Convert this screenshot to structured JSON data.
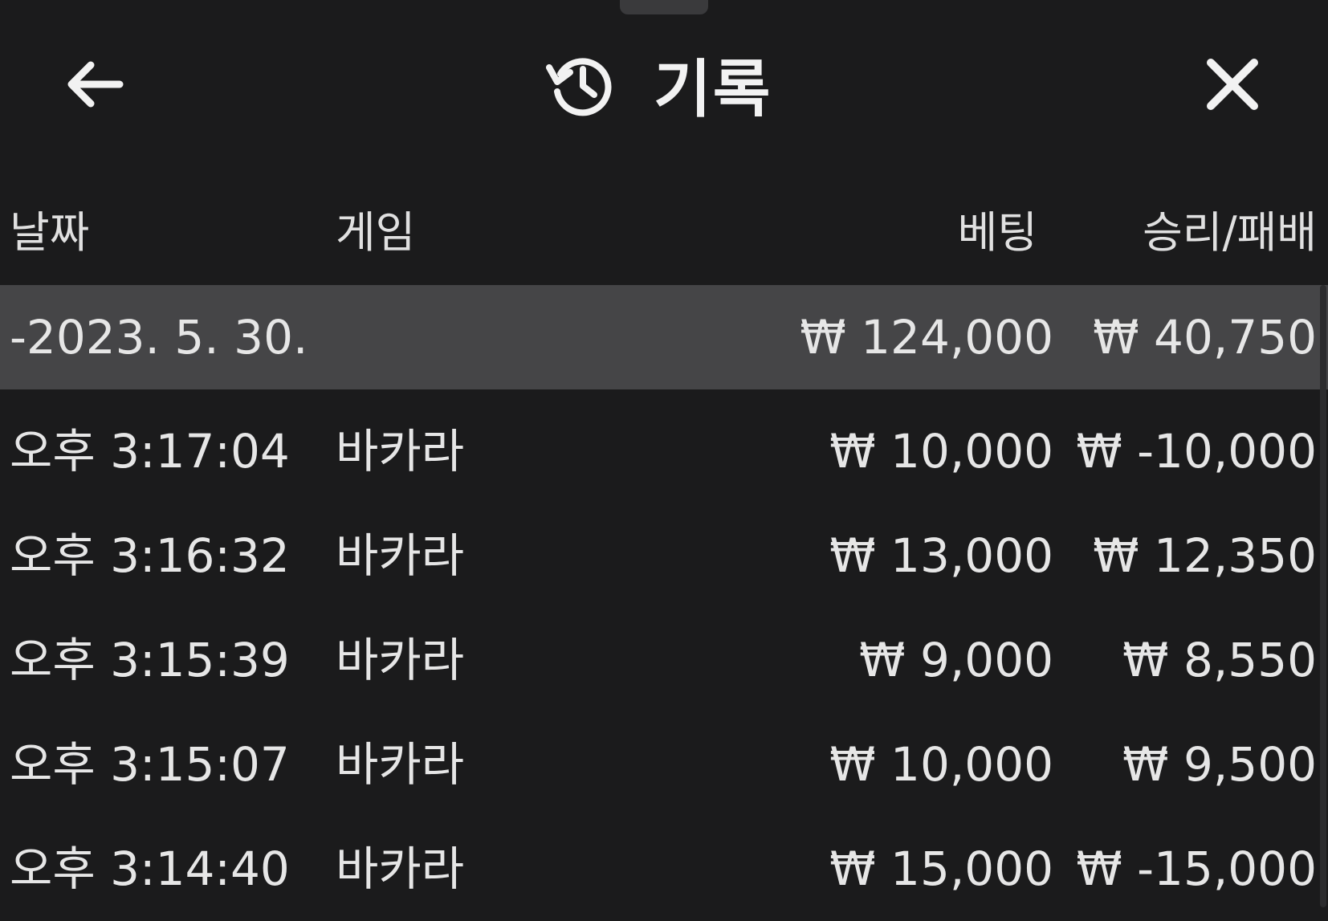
{
  "header": {
    "title": "기록",
    "back_icon": "arrow-left-icon",
    "history_icon": "history-icon",
    "close_icon": "close-icon"
  },
  "columns": {
    "date": "날짜",
    "game": "게임",
    "bet": "베팅",
    "result": "승리/패배"
  },
  "summary": {
    "date": "-2023. 5. 30.",
    "game": "",
    "bet": "₩ 124,000",
    "result": "₩ 40,750"
  },
  "rows": [
    {
      "date": "오후 3:17:04",
      "game": "바카라",
      "bet": "₩ 10,000",
      "result": "₩ -10,000"
    },
    {
      "date": "오후 3:16:32",
      "game": "바카라",
      "bet": "₩ 13,000",
      "result": "₩ 12,350"
    },
    {
      "date": "오후 3:15:39",
      "game": "바카라",
      "bet": "₩ 9,000",
      "result": "₩ 8,550"
    },
    {
      "date": "오후 3:15:07",
      "game": "바카라",
      "bet": "₩ 10,000",
      "result": "₩ 9,500"
    },
    {
      "date": "오후 3:14:40",
      "game": "바카라",
      "bet": "₩ 15,000",
      "result": "₩ -15,000"
    }
  ],
  "colors": {
    "background": "#1b1b1c",
    "summary_row": "#454547",
    "text": "#e6e6e6"
  }
}
